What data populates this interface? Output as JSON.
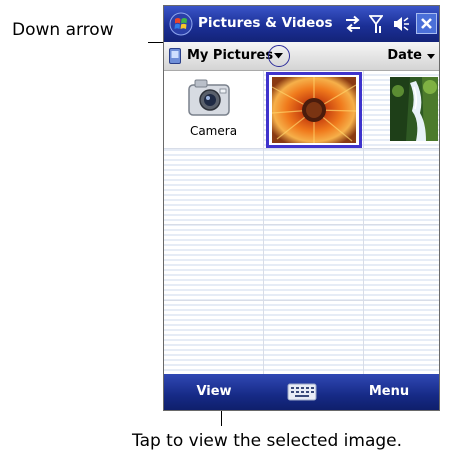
{
  "annotations": {
    "down_arrow_label": "Down arrow",
    "view_hint": "Tap to view the selected image."
  },
  "titlebar": {
    "title": "Pictures & Videos",
    "icons": [
      "start-icon",
      "sync-icon",
      "signal-icon",
      "volume-icon",
      "close-icon"
    ],
    "close_glyph": "×"
  },
  "folderbar": {
    "folder_name": "My Pictures",
    "folder_icon": "folder-icon",
    "dropdown_icon": "chevron-down-icon",
    "sort_label": "Date"
  },
  "grid": {
    "columns": 3,
    "items": [
      {
        "kind": "camera",
        "label": "Camera",
        "icon": "camera-icon"
      },
      {
        "kind": "image",
        "subject": "flower",
        "selected": true
      },
      {
        "kind": "image",
        "subject": "waterfall",
        "selected": false
      }
    ]
  },
  "softkeys": {
    "left": "View",
    "center_icon": "keyboard-icon",
    "right": "Menu"
  },
  "colors": {
    "titlebar": "#1b2f96",
    "selection": "#3f33cc",
    "softbar": "#162a86"
  }
}
